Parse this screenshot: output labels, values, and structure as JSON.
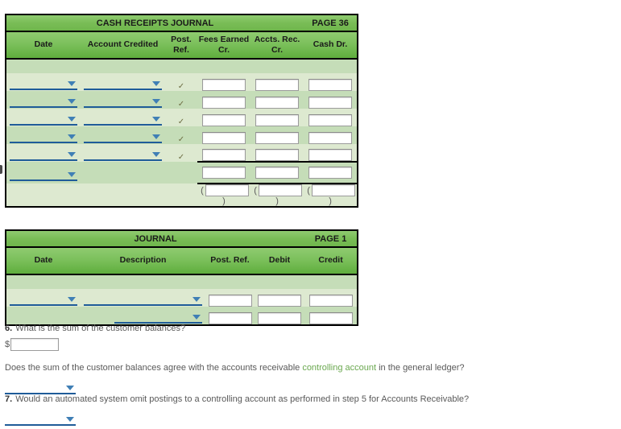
{
  "cash_receipts_journal": {
    "title": "CASH RECEIPTS JOURNAL",
    "page_label": "PAGE 36",
    "columns": [
      {
        "label": "Date"
      },
      {
        "label": "Account Credited"
      },
      {
        "label_line1": "Post.",
        "label_line2": "Ref."
      },
      {
        "label_line1": "Fees Earned",
        "label_line2": "Cr."
      },
      {
        "label": "Accts. Rec. Cr."
      },
      {
        "label": "Cash Dr."
      }
    ],
    "check_glyph": "✓",
    "rows": [
      {
        "date": "",
        "account": "",
        "post_ref": "✓",
        "fees_earned_cr": "",
        "accts_rec_cr": "",
        "cash_dr": ""
      },
      {
        "date": "",
        "account": "",
        "post_ref": "✓",
        "fees_earned_cr": "",
        "accts_rec_cr": "",
        "cash_dr": ""
      },
      {
        "date": "",
        "account": "",
        "post_ref": "✓",
        "fees_earned_cr": "",
        "accts_rec_cr": "",
        "cash_dr": ""
      },
      {
        "date": "",
        "account": "",
        "post_ref": "✓",
        "fees_earned_cr": "",
        "accts_rec_cr": "",
        "cash_dr": ""
      },
      {
        "date": "",
        "account": "",
        "post_ref": "✓",
        "fees_earned_cr": "",
        "accts_rec_cr": "",
        "cash_dr": ""
      }
    ],
    "totals_row": {
      "date": "",
      "fees_earned_cr": "",
      "accts_rec_cr": "",
      "cash_dr": ""
    },
    "posting_ref_row": {
      "open_paren": "(",
      "close_paren": ")",
      "fees_earned_cr": "",
      "accts_rec_cr": "",
      "cash_dr": ""
    }
  },
  "journal": {
    "title": "JOURNAL",
    "page_label": "PAGE 1",
    "columns": [
      {
        "label": "Date"
      },
      {
        "label": "Description"
      },
      {
        "label": "Post. Ref."
      },
      {
        "label": "Debit"
      },
      {
        "label": "Credit"
      }
    ],
    "rows": [
      {
        "date": "",
        "description": "",
        "post_ref": "",
        "debit": "",
        "credit": "",
        "indented": false
      },
      {
        "date": "",
        "description": "",
        "post_ref": "",
        "debit": "",
        "credit": "",
        "indented": true
      }
    ]
  },
  "questions": {
    "q6": {
      "number": "6.",
      "text": "What is the sum of the customer balances?",
      "currency_symbol": "$",
      "answer_value": "",
      "answer_placeholder": ""
    },
    "agree": {
      "text_before": "Does the sum of the customer balances agree with the accounts receivable ",
      "link_text": "controlling account",
      "text_after": " in the general ledger?",
      "selected": ""
    },
    "q7": {
      "number": "7.",
      "text": "Would an automated system omit postings to a controlling account as performed in step 5 for Accounts Receivable?",
      "selected": ""
    }
  },
  "colors": {
    "header_green_top": "#8fcb70",
    "header_green_bottom": "#5fae3d",
    "row_light": "#dde9d0",
    "row_dark": "#c5ddb8",
    "dropdown_blue": "#1f5c99",
    "caret_blue": "#3f7fb5",
    "link_green": "#6aa84f",
    "border_black": "#000000"
  }
}
